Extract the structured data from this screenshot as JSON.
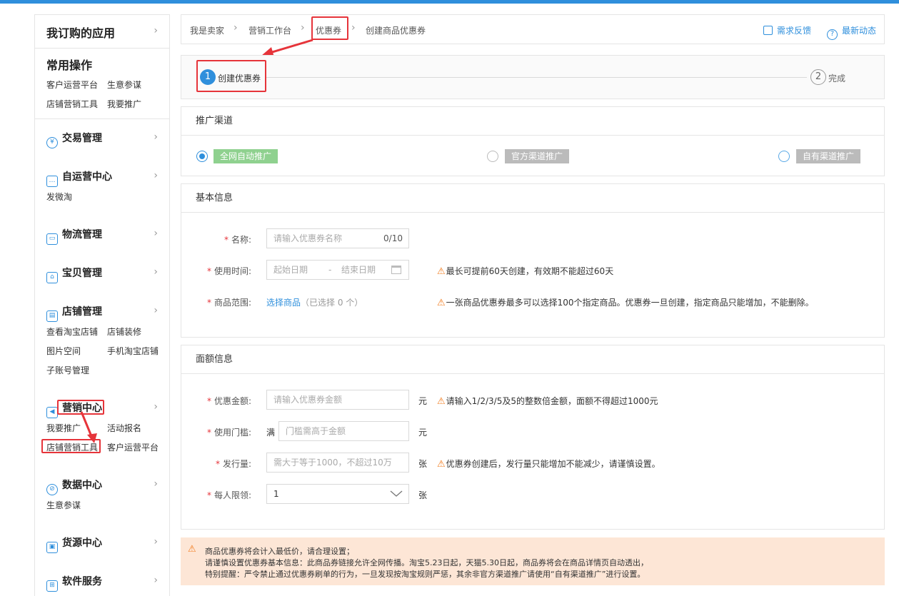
{
  "sidebar": {
    "my_apps": "我订购的应用",
    "common_title": "常用操作",
    "common_links": [
      "客户运营平台",
      "生意参谋",
      "店铺营销工具",
      "我要推广"
    ],
    "sections": {
      "trade": "交易管理",
      "self_op": "自运营中心",
      "self_op_links": [
        "发微淘"
      ],
      "logistics": "物流管理",
      "goods": "宝贝管理",
      "shop": "店铺管理",
      "shop_links": [
        "查看淘宝店铺",
        "店铺装修",
        "图片空间",
        "手机淘宝店铺",
        "子账号管理"
      ],
      "marketing": "营销中心",
      "marketing_links": [
        "我要推广",
        "活动报名",
        "店铺营销工具",
        "客户运营平台"
      ],
      "data": "数据中心",
      "data_links": [
        "生意参谋"
      ],
      "supply": "货源中心",
      "software": "软件服务"
    },
    "icons": {
      "trade": "¥",
      "self_op": "…",
      "logistics": "▭",
      "goods": "⌂",
      "shop": "▤",
      "marketing": "📢",
      "data": "⊘",
      "supply": "▣",
      "software": "⊞"
    }
  },
  "breadcrumb": {
    "items": [
      "我是卖家",
      "营销工作台",
      "优惠券",
      "创建商品优惠券"
    ],
    "feedback": "需求反馈",
    "news": "最新动态"
  },
  "steps": [
    {
      "num": "1",
      "label": "创建优惠券"
    },
    {
      "num": "2",
      "label": "完成"
    }
  ],
  "channel": {
    "title": "推广渠道",
    "options": [
      "全网自动推广",
      "官方渠道推广",
      "自有渠道推广"
    ]
  },
  "basic": {
    "title": "基本信息",
    "name_label": "名称:",
    "name_placeholder": "请输入优惠券名称",
    "name_count": "0/10",
    "time_label": "使用时间:",
    "start_placeholder": "起始日期",
    "date_sep": "-",
    "end_placeholder": "结束日期",
    "time_hint": "最长可提前60天创建，有效期不能超过60天",
    "range_label": "商品范围:",
    "range_link": "选择商品",
    "range_selected": "（已选择 0 个）",
    "range_hint": "一张商品优惠券最多可以选择100个指定商品。优惠券一旦创建，指定商品只能增加，不能删除。"
  },
  "amount": {
    "title": "面额信息",
    "coupon_label": "优惠金额:",
    "coupon_placeholder": "请输入优惠券金额",
    "yuan": "元",
    "coupon_hint": "请输入1/2/3/5及5的整数倍金额，面额不得超过1000元",
    "threshold_label": "使用门槛:",
    "threshold_prefix": "满",
    "threshold_placeholder": "门槛需高于金额",
    "issue_label": "发行量:",
    "issue_placeholder": "需大于等于1000，不超过10万",
    "zhang": "张",
    "issue_hint": "优惠券创建后，发行量只能增加不能减少，请谨慎设置。",
    "limit_label": "每人限领:",
    "limit_value": "1"
  },
  "notice": {
    "lines": [
      "商品优惠券将会计入最低价，请合理设置；",
      "请谨慎设置优惠券基本信息：此商品券链接允许全网传播。淘宝5.23日起，天猫5.30日起，商品券将会在商品详情页自动透出，",
      "特别提醒：严令禁止通过优惠券刷单的行为，一旦发现按淘宝规则严惩，其余非官方渠道推广请使用“自有渠道推广”进行设置。"
    ]
  },
  "colors": {
    "accent": "#2f8fdc",
    "highlight": "#e6343a",
    "warning": "#f27c1e",
    "notice_bg": "#fde6d6"
  }
}
